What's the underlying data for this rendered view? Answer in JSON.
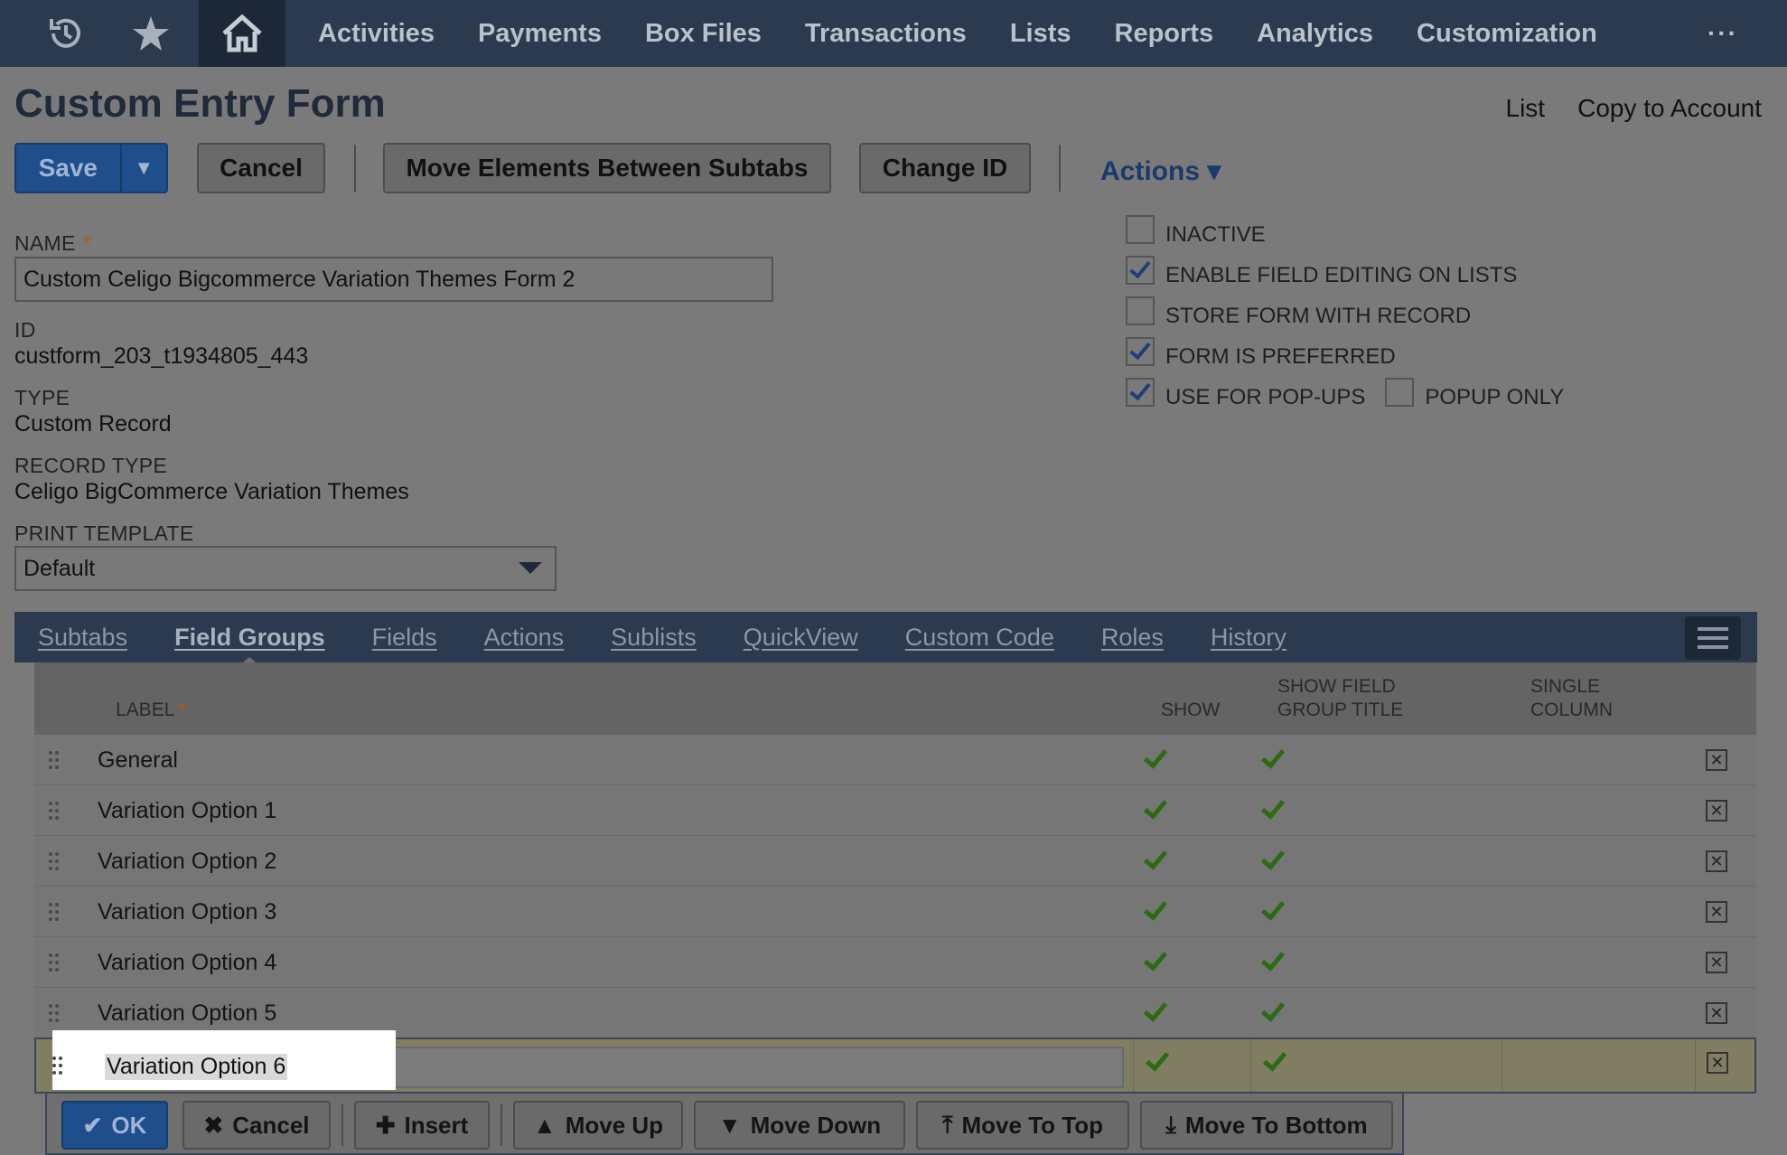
{
  "nav": {
    "items": [
      "Activities",
      "Payments",
      "Box Files",
      "Transactions",
      "Lists",
      "Reports",
      "Analytics",
      "Customization"
    ],
    "more": "···"
  },
  "header": {
    "title": "Custom Entry Form",
    "links": [
      "List",
      "Copy to Account"
    ]
  },
  "toolbar": {
    "save": "Save",
    "cancel": "Cancel",
    "move_elements": "Move Elements Between Subtabs",
    "change_id": "Change ID",
    "actions": "Actions ▾"
  },
  "form": {
    "name_label": "NAME",
    "name_value": "Custom Celigo Bigcommerce Variation Themes Form 2",
    "id_label": "ID",
    "id_value": "custform_203_t1934805_443",
    "type_label": "TYPE",
    "type_value": "Custom Record",
    "record_type_label": "RECORD TYPE",
    "record_type_value": "Celigo BigCommerce Variation Themes",
    "print_template_label": "PRINT TEMPLATE",
    "print_template_value": "Default",
    "required_mark": "*"
  },
  "options": {
    "inactive": {
      "label": "INACTIVE",
      "checked": false
    },
    "enable_field_editing": {
      "label": "ENABLE FIELD EDITING ON LISTS",
      "checked": true
    },
    "store_form": {
      "label": "STORE FORM WITH RECORD",
      "checked": false
    },
    "form_preferred": {
      "label": "FORM IS PREFERRED",
      "checked": true
    },
    "use_for_popups": {
      "label": "USE FOR POP-UPS",
      "checked": true
    },
    "popup_only": {
      "label": "POPUP ONLY",
      "checked": false
    }
  },
  "tabs": [
    "Subtabs",
    "Field Groups",
    "Fields",
    "Actions",
    "Sublists",
    "QuickView",
    "Custom Code",
    "Roles",
    "History"
  ],
  "active_tab": "Field Groups",
  "grid": {
    "col_label": "LABEL",
    "col_show": "SHOW",
    "col_show_title_1": "SHOW FIELD",
    "col_show_title_2": "GROUP TITLE",
    "col_single_1": "SINGLE",
    "col_single_2": "COLUMN",
    "rows": [
      {
        "label": "General",
        "show": true,
        "show_title": true
      },
      {
        "label": "Variation Option 1",
        "show": true,
        "show_title": true
      },
      {
        "label": "Variation Option 2",
        "show": true,
        "show_title": true
      },
      {
        "label": "Variation Option 3",
        "show": true,
        "show_title": true
      },
      {
        "label": "Variation Option 4",
        "show": true,
        "show_title": true
      },
      {
        "label": "Variation Option 5",
        "show": true,
        "show_title": true
      }
    ],
    "edit_row": {
      "label": "Variation Option 6",
      "show": true,
      "show_title": true
    }
  },
  "row_actions": {
    "ok": "OK",
    "cancel": "Cancel",
    "insert": "Insert",
    "move_up": "Move Up",
    "move_down": "Move Down",
    "move_top": "Move To Top",
    "move_bottom": "Move To Bottom"
  },
  "colors": {
    "nav_bg": "#2b3a4e",
    "primary_button": "#1e4f8c",
    "check_green": "#2c6b14",
    "edit_row_bg": "#807d62"
  }
}
